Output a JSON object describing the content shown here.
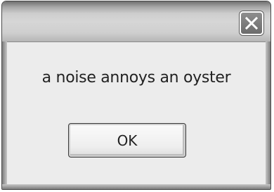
{
  "dialog": {
    "title": "",
    "message": "a noise annoys an oyster",
    "ok_label": "OK",
    "close_icon": "close-icon"
  },
  "colors": {
    "titlebar": "#cdcdcd",
    "client_background": "#ececec",
    "text": "#222222"
  }
}
